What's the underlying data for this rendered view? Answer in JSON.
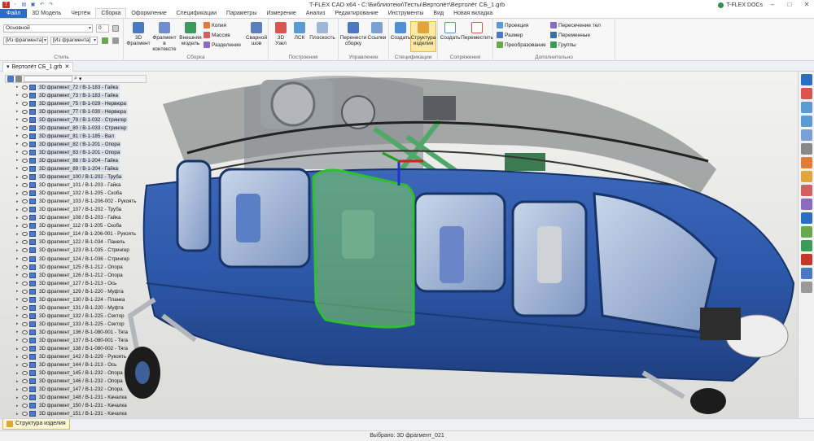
{
  "app": {
    "title": "T-FLEX CAD x64 - С:\\Библиотеки\\Тесты\\Вертолёт\\Вертолёт СБ_1.grb",
    "docs_label": "T-FLEX DOCs",
    "window_min": "–",
    "window_max": "□",
    "window_close": "✕"
  },
  "tabs": [
    "Файл",
    "3D Модель",
    "Чертёж",
    "Сборка",
    "Оформление",
    "Спецификации",
    "Параметры",
    "Измерение",
    "Анализ",
    "Редактирование",
    "Инструменты",
    "Вид",
    "Новая вкладка"
  ],
  "active_tab": "Сборка",
  "ribbon": {
    "style_group": {
      "label": "Стиль",
      "layer_value": "Основной",
      "layer_num": "0",
      "frag1": "[Из фрагмента]",
      "frag2": "[Из фрагмента]"
    },
    "assembly_group": {
      "label": "Сборка",
      "btn_fragment": "3D Фрагмент",
      "btn_context": "Фрагмент в контексте",
      "btn_external": "Внешняя модель",
      "btn_copy": "Копия",
      "btn_array": "Массив",
      "btn_split": "Разделение",
      "btn_weld": "Сварной шов"
    },
    "build_group": {
      "label": "Построения",
      "btn_node": "3D Узел",
      "btn_lcs": "ЛСК",
      "btn_plane": "Плоскость"
    },
    "manage_group": {
      "label": "Управление",
      "btn_move": "Перенести сборку",
      "btn_links": "Ссылки"
    },
    "spec_group": {
      "label": "Спецификации",
      "btn_create": "Создать",
      "btn_structure": "Структура изделия"
    },
    "mate_group": {
      "label": "Сопряжения",
      "btn_create": "Создать",
      "btn_move": "Переместить"
    },
    "extra_group": {
      "label": "Дополнительно",
      "btn_projection": "Проекция",
      "btn_size": "Размер",
      "btn_transform": "Преобразование",
      "btn_intersect": "Пересечение тел",
      "btn_vars": "Переменные",
      "btn_groups": "Группы"
    }
  },
  "doc_tab": "Вертолёт СБ_1.grb",
  "tree_rows": [
    {
      "label": "3D фрагмент_72 / В-1-183 - Гайка",
      "sel": true,
      "exp": "▸"
    },
    {
      "label": "3D фрагмент_73 / В-1-183 - Гайка",
      "sel": true,
      "exp": "▸"
    },
    {
      "label": "3D фрагмент_75 / В-1-029 - Нервюра",
      "sel": true,
      "exp": "▸"
    },
    {
      "label": "3D фрагмент_77 / В-1-030 - Нервюра",
      "sel": true,
      "exp": "▸"
    },
    {
      "label": "3D фрагмент_79 / В-1-032 - Стрингер",
      "sel": true,
      "exp": "▸"
    },
    {
      "label": "3D фрагмент_80 / В-1-033 - Стрингер",
      "sel": true,
      "exp": "▸"
    },
    {
      "label": "3D фрагмент_81 / В-1-185 - Вал",
      "sel": true,
      "exp": "▸"
    },
    {
      "label": "3D фрагмент_82 / В-1-201 - Опора",
      "sel": true,
      "exp": "▸"
    },
    {
      "label": "3D фрагмент_83 / В-1-201 - Опора",
      "sel": true,
      "exp": "▸"
    },
    {
      "label": "3D фрагмент_88 / В-1-204 - Гайка",
      "sel": true,
      "exp": "▸"
    },
    {
      "label": "3D фрагмент_89 / В-1-204 - Гайка",
      "sel": true,
      "exp": "▸"
    },
    {
      "label": "3D фрагмент_100 / В-1-202 - Труба",
      "sel": true,
      "exp": "▸"
    },
    {
      "label": "3D фрагмент_101 / В-1-203 - Гайка",
      "sel": false,
      "exp": "▸"
    },
    {
      "label": "3D фрагмент_102 / В-1-205 - Скоба",
      "sel": false,
      "exp": "▸"
    },
    {
      "label": "3D фрагмент_103 / В-1-206-002 - Рукоять",
      "sel": false,
      "exp": "▸"
    },
    {
      "label": "3D фрагмент_107 / В-1-202 - Труба",
      "sel": false,
      "exp": "▸"
    },
    {
      "label": "3D фрагмент_108 / В-1-203 - Гайка",
      "sel": false,
      "exp": "▸"
    },
    {
      "label": "3D фрагмент_112 / В-1-205 - Скоба",
      "sel": false,
      "exp": "▸"
    },
    {
      "label": "3D фрагмент_114 / В-1-206-001 - Рукоять",
      "sel": false,
      "exp": "▸"
    },
    {
      "label": "3D фрагмент_122 / В-1-034 - Панель",
      "sel": false,
      "exp": "▸"
    },
    {
      "label": "3D фрагмент_123 / В-1-035 - Стрингер",
      "sel": false,
      "exp": "▸"
    },
    {
      "label": "3D фрагмент_124 / В-1-036 - Стрингер",
      "sel": false,
      "exp": "▸"
    },
    {
      "label": "3D фрагмент_125 / В-1-212 - Опора",
      "sel": false,
      "exp": "▸"
    },
    {
      "label": "3D фрагмент_126 / В-1-212 - Опора",
      "sel": false,
      "exp": "▸"
    },
    {
      "label": "3D фрагмент_127 / В-1-213 - Ось",
      "sel": false,
      "exp": "▸"
    },
    {
      "label": "3D фрагмент_129 / В-1-220 - Муфта",
      "sel": false,
      "exp": "▸"
    },
    {
      "label": "3D фрагмент_130 / В-1-224 - Планка",
      "sel": false,
      "exp": "▸"
    },
    {
      "label": "3D фрагмент_131 / В-1-220 - Муфта",
      "sel": false,
      "exp": "▸"
    },
    {
      "label": "3D фрагмент_132 / В-1-225 - Сектор",
      "sel": false,
      "exp": "▸"
    },
    {
      "label": "3D фрагмент_133 / В-1-225 - Сектор",
      "sel": false,
      "exp": "▸"
    },
    {
      "label": "3D фрагмент_136 / В-1-080-001 - Тяга",
      "sel": false,
      "exp": "▸"
    },
    {
      "label": "3D фрагмент_137 / В-1-080-001 - Тяга",
      "sel": false,
      "exp": "▸"
    },
    {
      "label": "3D фрагмент_138 / В-1-080-002 - Тяга",
      "sel": false,
      "exp": "▸"
    },
    {
      "label": "3D фрагмент_142 / В-1-229 - Рукоять",
      "sel": false,
      "exp": "▸"
    },
    {
      "label": "3D фрагмент_144 / В-1-213 - Ось",
      "sel": false,
      "exp": "▸"
    },
    {
      "label": "3D фрагмент_145 / В-1-232 - Опора",
      "sel": false,
      "exp": "▸"
    },
    {
      "label": "3D фрагмент_146 / В-1-232 - Опора",
      "sel": false,
      "exp": "▸"
    },
    {
      "label": "3D фрагмент_147 / В-1-232 - Опора",
      "sel": false,
      "exp": "▸"
    },
    {
      "label": "3D фрагмент_148 / В-1-231 - Качалка",
      "sel": false,
      "exp": "▸"
    },
    {
      "label": "3D фрагмент_150 / В-1-231 - Качалка",
      "sel": false,
      "exp": "▸"
    },
    {
      "label": "3D фрагмент_151 / В-1-231 - Качалка",
      "sel": false,
      "exp": "▸"
    }
  ],
  "bottom_tab": "Структура изделия",
  "status": "Выбрано: 3D фрагмент_021"
}
